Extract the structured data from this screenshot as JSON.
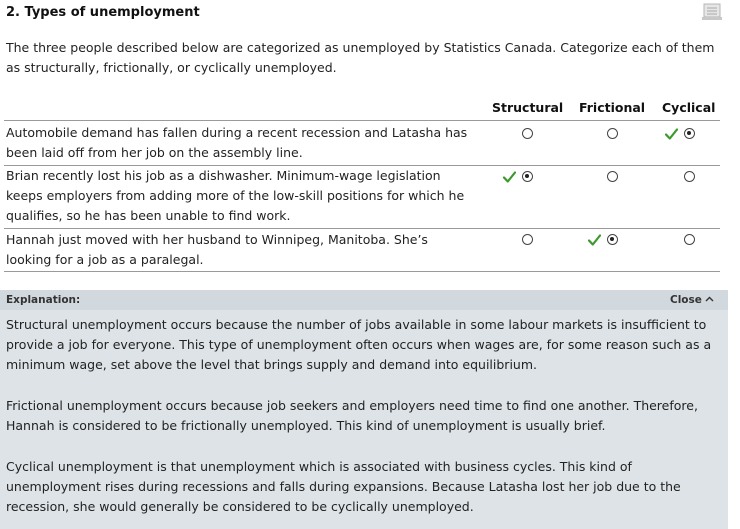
{
  "question": {
    "title": "2. Types of unemployment",
    "intro": "The three people described below are categorized as unemployed by Statistics Canada. Categorize each of them as structurally, frictionally, or cyclically unemployed."
  },
  "columns": [
    "Structural",
    "Frictional",
    "Cyclical"
  ],
  "rows": [
    {
      "text": "Automobile demand has fallen during a recent recession and Latasha has been laid off from her job on the assembly line.",
      "selected": "Cyclical",
      "correct": true
    },
    {
      "text": "Brian recently lost his job as a dishwasher. Minimum-wage legislation keeps employers from adding more of the low-skill positions for which he qualifies, so he has been unable to find work.",
      "selected": "Structural",
      "correct": true
    },
    {
      "text": "Hannah just moved with her husband to Winnipeg, Manitoba. She’s looking for a job as a paralegal.",
      "selected": "Frictional",
      "correct": true
    }
  ],
  "explanation": {
    "label": "Explanation:",
    "close_label": "Close",
    "paragraphs": [
      "Structural unemployment occurs because the number of jobs available in some labour markets is insufficient to provide a job for everyone. This type of unemployment often occurs when wages are, for some reason such as a minimum wage, set above the level that brings supply and demand into equilibrium.",
      "Frictional unemployment occurs because job seekers and employers need time to find one another. Therefore, Hannah is considered to be frictionally unemployed. This kind of unemployment is usually brief.",
      "Cyclical unemployment is that unemployment which is associated with business cycles. This kind of unemployment rises during recessions and falls during expansions. Because Latasha lost her job due to the recession, she would generally be considered to be cyclically unemployed."
    ]
  },
  "colors": {
    "check": "#3a9a2a",
    "explanation_bg": "#dde3e7"
  },
  "icons": {
    "notes": "notes-icon",
    "check": "checkmark-icon",
    "close": "chevron-up-icon"
  }
}
